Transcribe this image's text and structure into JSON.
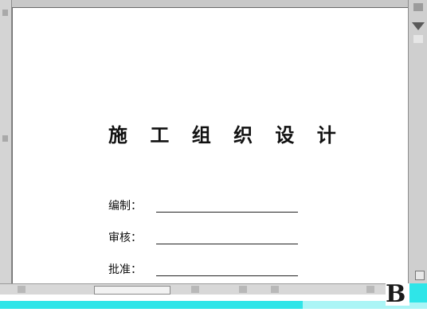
{
  "document": {
    "title": "施 工 组 织 设 计",
    "signatures": [
      {
        "label": "编制："
      },
      {
        "label": "审核："
      },
      {
        "label": "批准："
      }
    ]
  },
  "watermark": {
    "logo_text": "B"
  },
  "colors": {
    "frame_gray": "#d4d4d4",
    "taskbar_cyan": "#2fe5e8",
    "page_white": "#ffffff",
    "text": "#111111"
  }
}
